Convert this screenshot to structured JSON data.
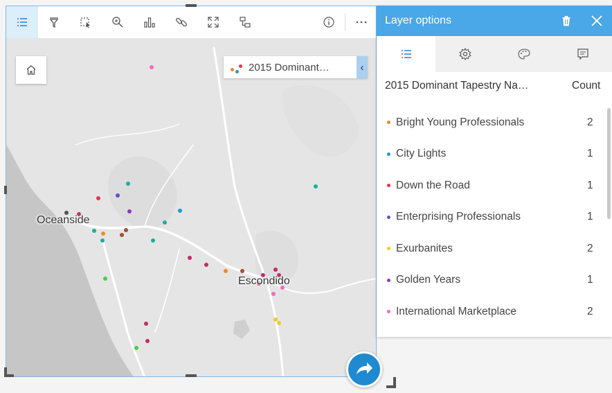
{
  "toolbar": {
    "items": [
      "list-icon",
      "filter-icon",
      "select-icon",
      "zoom-icon",
      "bar-chart-icon",
      "link-icon",
      "expand-icon",
      "transform-icon",
      "info-icon",
      "more-icon"
    ]
  },
  "legend_chip": {
    "label": "2015 Dominant…",
    "toggle": "‹"
  },
  "map": {
    "labels": {
      "oceanside": "Oceanside",
      "escondido": "Escondido"
    }
  },
  "panel": {
    "title": "Layer options",
    "columns": {
      "name": "2015 Dominant Tapestry Na…",
      "count": "Count"
    },
    "rows": [
      {
        "name": "Bright Young Professionals",
        "count": "2",
        "color": "#f08a24"
      },
      {
        "name": "City Lights",
        "count": "1",
        "color": "#1c9ad6"
      },
      {
        "name": "Down the Road",
        "count": "1",
        "color": "#e8344a"
      },
      {
        "name": "Enterprising Professionals",
        "count": "1",
        "color": "#5a56c6"
      },
      {
        "name": "Exurbanites",
        "count": "2",
        "color": "#f7c81e"
      },
      {
        "name": "Golden Years",
        "count": "1",
        "color": "#8e3ab1"
      },
      {
        "name": "International Marketplace",
        "count": "2",
        "color": "#f26bbf"
      }
    ]
  }
}
